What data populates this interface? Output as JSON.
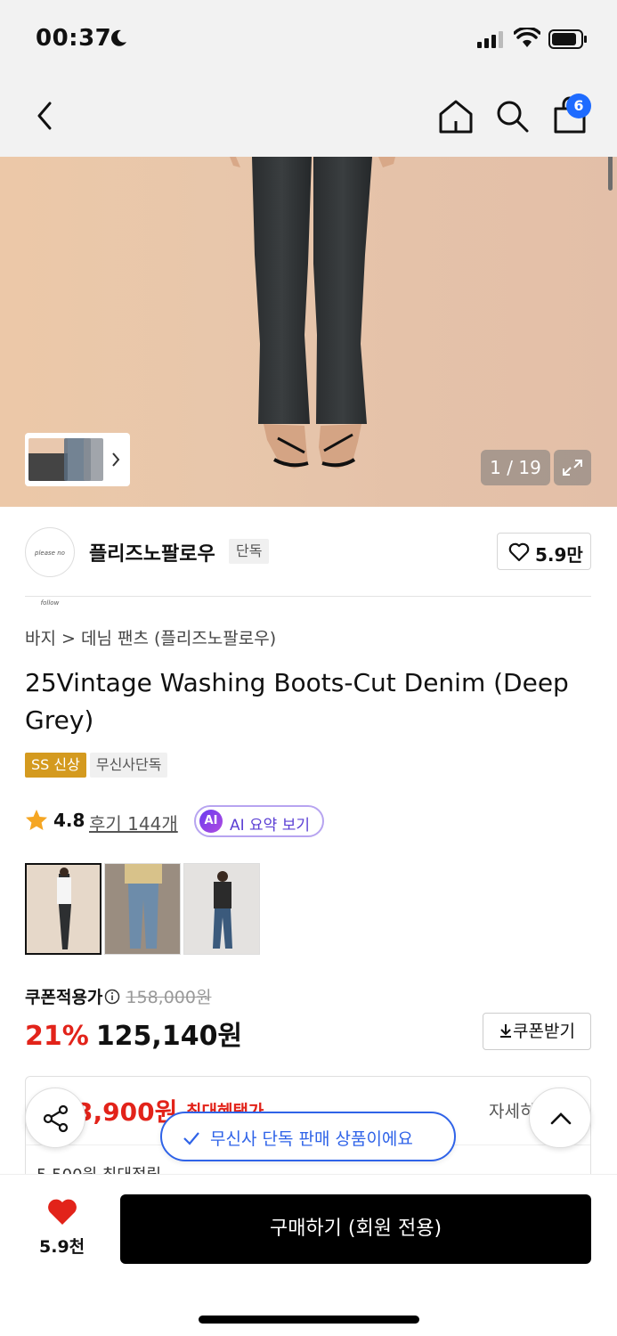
{
  "status_bar": {
    "time": "00:37"
  },
  "nav": {
    "cart_count": "6"
  },
  "gallery": {
    "counter": "1 / 19"
  },
  "brand": {
    "logo_text": "please no follow",
    "name": "플리즈노팔로우",
    "tag": "단독",
    "likes": "5.9만"
  },
  "breadcrumb": "바지 > 데님 팬츠 (플리즈노팔로우)",
  "product": {
    "title": "25Vintage Washing Boots-Cut Denim (Deep Grey)",
    "badges": [
      "SS 신상",
      "무신사단독"
    ],
    "rating": "4.8",
    "reviews": "후기 144개",
    "ai_badge": "AI",
    "ai_summary": "AI 요약 보기"
  },
  "pricing": {
    "coupon_label": "쿠폰적용가",
    "original": "158,000원",
    "discount": "21%",
    "price": "125,140원",
    "coupon_button": "쿠폰받기"
  },
  "benefit": {
    "max_price": "3,900원",
    "max_label": "최대혜택가",
    "detail": "자세히",
    "points": "5,500원 최대적립"
  },
  "toast": "무신사 단독 판매 상품이에요",
  "bottom": {
    "like_count": "5.9천",
    "buy_button": "구매하기 (회원 전용)"
  },
  "colors": {
    "accent_red": "#e2231a",
    "accent_blue": "#2f63e8",
    "badge_orange": "#d49a1f",
    "ai_purple": "#5b3fd4"
  }
}
